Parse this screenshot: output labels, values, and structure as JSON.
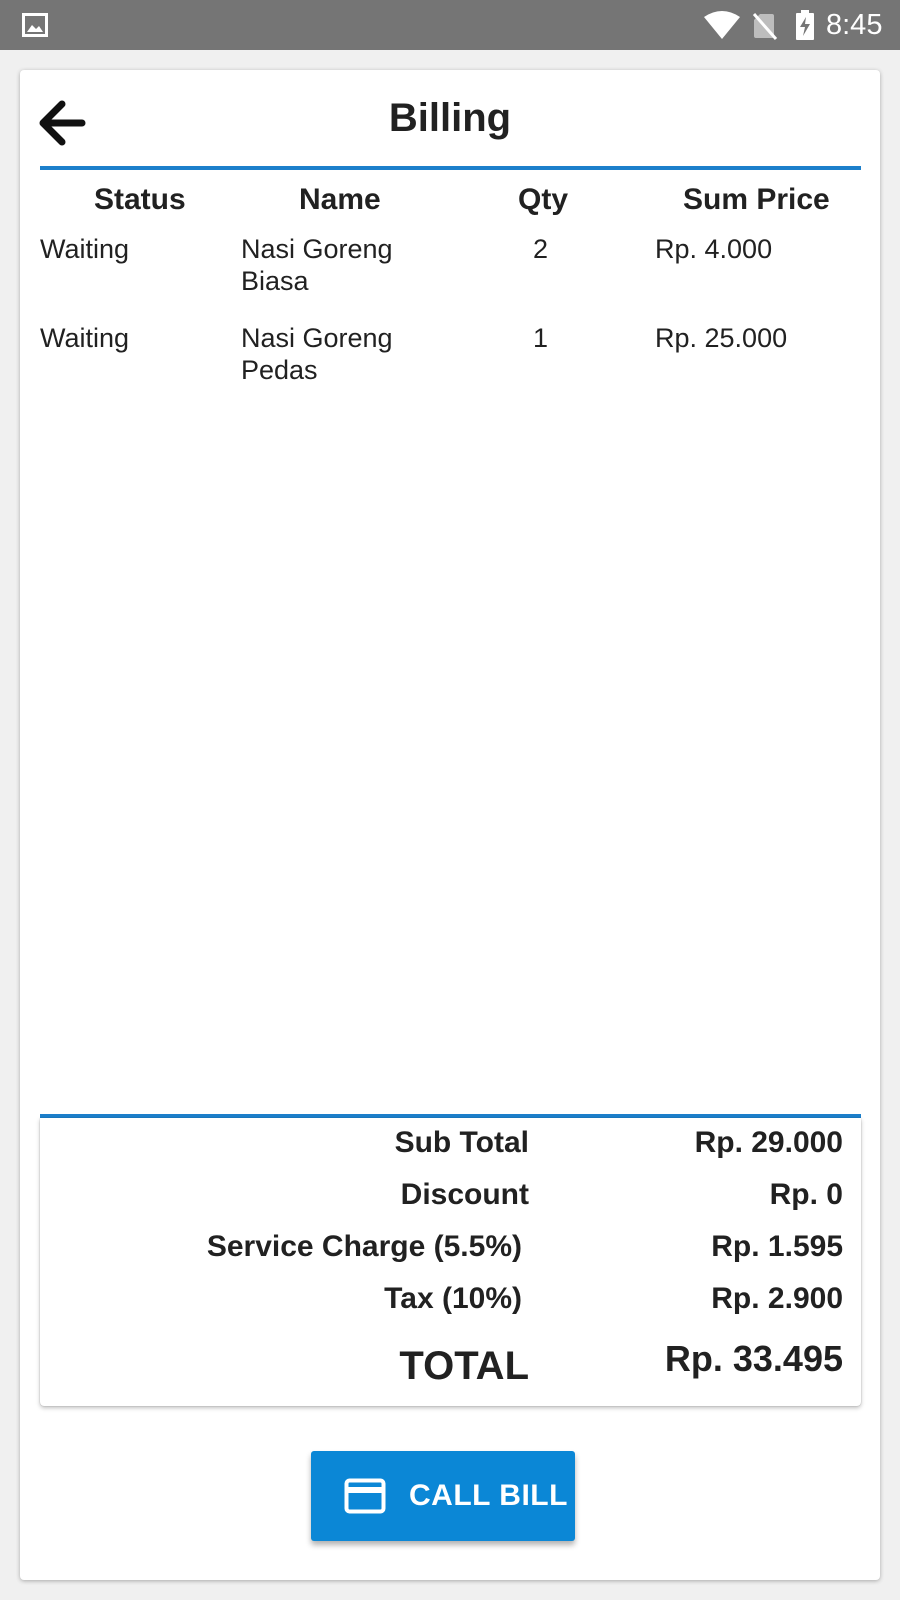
{
  "status_bar": {
    "time": "8:45",
    "icons": [
      "gallery-icon",
      "wifi-icon",
      "no-sim-icon",
      "battery-charging-icon"
    ]
  },
  "header": {
    "title": "Billing",
    "back_icon": "arrow-back-icon"
  },
  "table": {
    "columns": [
      "Status",
      "Name",
      "Qty",
      "Sum Price"
    ],
    "rows": [
      {
        "status": "Waiting",
        "name_line1": "Nasi Goreng",
        "name_line2": "Biasa",
        "qty": "2",
        "sum_price": "Rp. 4.000"
      },
      {
        "status": "Waiting",
        "name_line1": "Nasi Goreng",
        "name_line2": "Pedas",
        "qty": "1",
        "sum_price": "Rp. 25.000"
      }
    ]
  },
  "summary": {
    "sub_total_label": "Sub Total",
    "sub_total_value": "Rp. 29.000",
    "discount_label": "Discount",
    "discount_value": "Rp. 0",
    "service_label": "Service Charge (5.5%)",
    "service_value": "Rp. 1.595",
    "tax_label": "Tax (10%)",
    "tax_value": "Rp. 2.900",
    "total_label": "TOTAL",
    "total_value": "Rp. 33.495"
  },
  "call_bill": {
    "label": "CALL BILL",
    "icon": "credit-card-icon"
  },
  "colors": {
    "accent": "#1c7fcb",
    "button": "#0b87d6",
    "status_bar": "#757575"
  }
}
